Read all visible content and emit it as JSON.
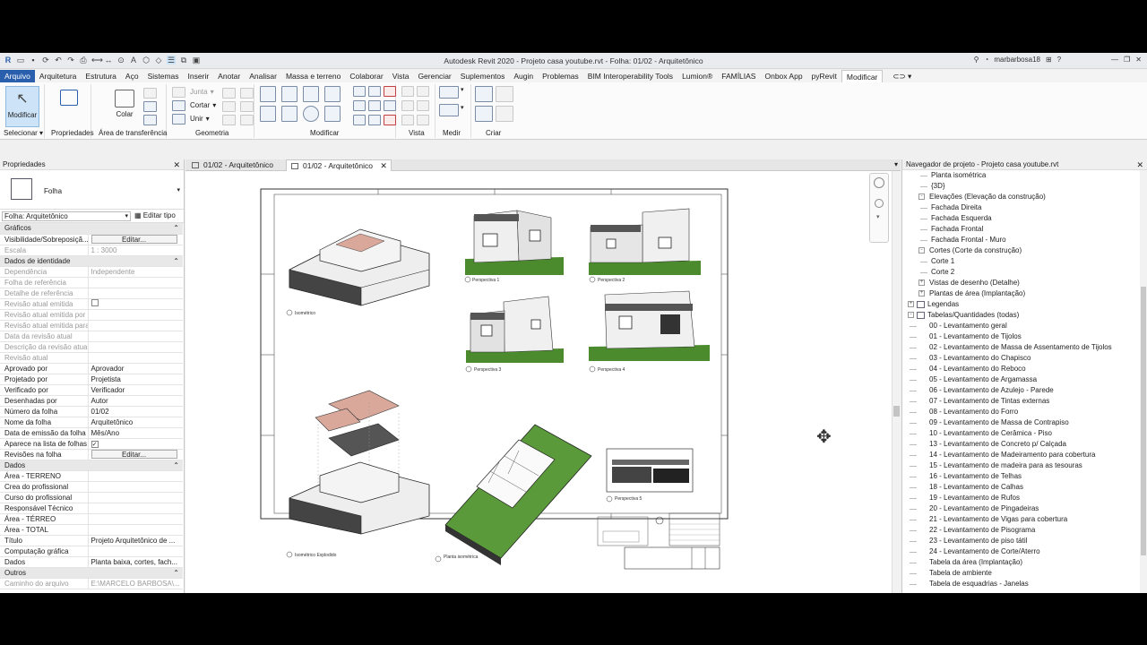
{
  "titlebar": {
    "title": "Autodesk Revit 2020 - Projeto casa youtube.rvt - Folha: 01/02 - Arquitetônico",
    "user": "marbarbosa18",
    "help": "?"
  },
  "menu_tabs": [
    "Arquivo",
    "Arquitetura",
    "Estrutura",
    "Aço",
    "Sistemas",
    "Inserir",
    "Anotar",
    "Analisar",
    "Massa e terreno",
    "Colaborar",
    "Vista",
    "Gerenciar",
    "Suplementos",
    "Augin",
    "Problemas",
    "BIM Interoperability Tools",
    "Lumion®",
    "FAMÍLIAS",
    "Onbox App",
    "pyRevit",
    "Modificar"
  ],
  "ribbon": {
    "modificar_label": "Modificar",
    "colar_label": "Colar",
    "junta_label": "Junta",
    "cortar_label": "Cortar",
    "unir_label": "Unir",
    "groups": {
      "selecionar": "Selecionar",
      "propriedades": "Propriedades",
      "transferencia": "Área de transferência",
      "geometria": "Geometria",
      "modificar": "Modificar",
      "vista": "Vista",
      "medir": "Medir",
      "criar": "Criar"
    }
  },
  "properties": {
    "title": "Propriedades",
    "type_name": "Folha",
    "filter": "Folha: Arquitetônico",
    "edit_type": "Editar tipo",
    "rows": [
      {
        "kind": "sec",
        "k": "Gráficos"
      },
      {
        "k": "Visibilidade/Sobreposiçã...",
        "v": "Editar...",
        "btn": true
      },
      {
        "k": "Escala",
        "v": "1 : 3000",
        "dim": true
      },
      {
        "kind": "sec",
        "k": "Dados de identidade"
      },
      {
        "k": "Dependência",
        "v": "Independente",
        "dim": true
      },
      {
        "k": "Folha de referência",
        "v": "",
        "dim": true
      },
      {
        "k": "Detalhe de referência",
        "v": "",
        "dim": true
      },
      {
        "k": "Revisão atual emitida",
        "v": "",
        "dim": true,
        "chk": true
      },
      {
        "k": "Revisão atual emitida por",
        "v": "",
        "dim": true
      },
      {
        "k": "Revisão atual emitida para",
        "v": "",
        "dim": true
      },
      {
        "k": "Data da revisão atual",
        "v": "",
        "dim": true
      },
      {
        "k": "Descrição da revisão atual",
        "v": "",
        "dim": true
      },
      {
        "k": "Revisão atual",
        "v": "",
        "dim": true
      },
      {
        "k": "Aprovado por",
        "v": "Aprovador"
      },
      {
        "k": "Projetado por",
        "v": "Projetista"
      },
      {
        "k": "Verificado por",
        "v": "Verificador"
      },
      {
        "k": "Desenhadas por",
        "v": "Autor"
      },
      {
        "k": "Número da folha",
        "v": "01/02"
      },
      {
        "k": "Nome da folha",
        "v": "Arquitetônico"
      },
      {
        "k": "Data de emissão da folha",
        "v": "Mês/Ano"
      },
      {
        "k": "Aparece na lista de folhas",
        "v": "",
        "chk": true,
        "checked": true
      },
      {
        "k": "Revisões na folha",
        "v": "Editar...",
        "btn": true
      },
      {
        "kind": "sec",
        "k": "Dados"
      },
      {
        "k": "Área - TERRENO",
        "v": ""
      },
      {
        "k": "Crea do profissional",
        "v": ""
      },
      {
        "k": "Curso do profissional",
        "v": ""
      },
      {
        "k": "Responsável Técnico",
        "v": ""
      },
      {
        "k": "Área - TÉRREO",
        "v": ""
      },
      {
        "k": "Área - TOTAL",
        "v": ""
      },
      {
        "k": "Título",
        "v": "Projeto Arquitetônico de ..."
      },
      {
        "k": "Computação gráfica",
        "v": ""
      },
      {
        "k": "Dados",
        "v": "Planta baixa, cortes, fach..."
      },
      {
        "kind": "sec",
        "k": "Outros"
      },
      {
        "k": "Caminho do arquivo",
        "v": "E:\\MARCELO BARBOSA\\...",
        "dim": true
      }
    ]
  },
  "view_tabs": [
    {
      "label": "01/02 - Arquitetônico",
      "active": false
    },
    {
      "label": "01/02 - Arquitetônico",
      "active": true
    }
  ],
  "sheet": {
    "labels": [
      "Isométrico",
      "Perspectiva 1",
      "Perspectiva 2",
      "Perspectiva 3",
      "Perspectiva 4",
      "Isométrico Explodido",
      "Planta isométrica",
      "Perspectiva 5"
    ]
  },
  "navigator": {
    "title": "Navegador de projeto - Projeto casa youtube.rvt",
    "items": [
      {
        "label": "Planta isométrica",
        "level": 3
      },
      {
        "label": "{3D}",
        "level": 3
      },
      {
        "label": "Elevações (Elevação da construção)",
        "level": 2,
        "exp": "-"
      },
      {
        "label": "Fachada Direita",
        "level": 3
      },
      {
        "label": "Fachada Esquerda",
        "level": 3
      },
      {
        "label": "Fachada Frontal",
        "level": 3
      },
      {
        "label": "Fachada Frontal - Muro",
        "level": 3
      },
      {
        "label": "Cortes (Corte da construção)",
        "level": 2,
        "exp": "-"
      },
      {
        "label": "Corte 1",
        "level": 3
      },
      {
        "label": "Corte 2",
        "level": 3
      },
      {
        "label": "Vistas de desenho (Detalhe)",
        "level": 2,
        "exp": "+"
      },
      {
        "label": "Plantas de área (Implantação)",
        "level": 2,
        "exp": "+"
      },
      {
        "label": "Legendas",
        "level": 1,
        "exp": "+",
        "icon": true
      },
      {
        "label": "Tabelas/Quantidades (todas)",
        "level": 1,
        "exp": "-",
        "icon": true
      },
      {
        "label": "00 - Levantamento geral",
        "level": 2
      },
      {
        "label": "01 - Levantamento de Tijolos",
        "level": 2
      },
      {
        "label": "02 - Levantamento de Massa de Assentamento de Tijolos",
        "level": 2
      },
      {
        "label": "03 - Levantamento do Chapisco",
        "level": 2
      },
      {
        "label": "04 - Levantamento do Reboco",
        "level": 2
      },
      {
        "label": "05 - Levantamento de Argamassa",
        "level": 2
      },
      {
        "label": "06 - Levantamento de Azulejo - Parede",
        "level": 2
      },
      {
        "label": "07 - Levantamento de Tintas externas",
        "level": 2
      },
      {
        "label": "08 - Levantamento do Forro",
        "level": 2
      },
      {
        "label": "09 - Levantamento de Massa de Contrapiso",
        "level": 2
      },
      {
        "label": "10 - Levantamento de Cerâmica - Piso",
        "level": 2
      },
      {
        "label": "13 - Levantamento de Concreto p/ Calçada",
        "level": 2
      },
      {
        "label": "14 - Levantamento de Madeiramento para cobertura",
        "level": 2
      },
      {
        "label": "15 - Levantamento de madeira para as tesouras",
        "level": 2
      },
      {
        "label": "16 - Levantamento de Telhas",
        "level": 2
      },
      {
        "label": "18 - Levantamento de Calhas",
        "level": 2
      },
      {
        "label": "19 - Levantamento de Rufos",
        "level": 2
      },
      {
        "label": "20 - Levantamento de Pingadeiras",
        "level": 2
      },
      {
        "label": "21 - Levantamento de Vigas para cobertura",
        "level": 2
      },
      {
        "label": "22 - Levantamento de Pisograma",
        "level": 2
      },
      {
        "label": "23 - Levantamento de piso tátil",
        "level": 2
      },
      {
        "label": "24 - Levantamento de Corte/Aterro",
        "level": 2
      },
      {
        "label": "Tabela da área (Implantação)",
        "level": 2
      },
      {
        "label": "Tabela de ambiente",
        "level": 2
      },
      {
        "label": "Tabela de esquadrias - Janelas",
        "level": 2
      }
    ]
  }
}
